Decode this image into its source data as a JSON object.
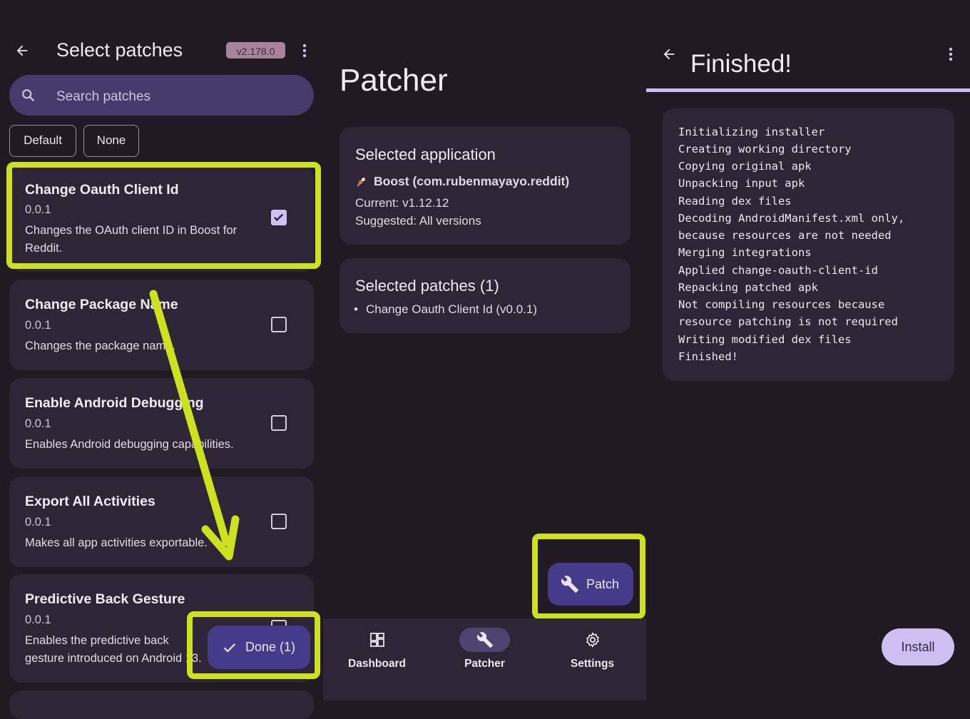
{
  "select_patches": {
    "title": "Select patches",
    "version_badge": "v2.178.0",
    "search_placeholder": "Search patches",
    "chips": [
      "Default",
      "None"
    ],
    "patches": [
      {
        "name": "Change Oauth Client Id",
        "version": "0.0.1",
        "desc": "Changes the OAuth client ID in Boost for Reddit.",
        "checked": true
      },
      {
        "name": "Change Package Name",
        "version": "0.0.1",
        "desc": "Changes the package name.",
        "checked": false
      },
      {
        "name": "Enable Android Debugging",
        "version": "0.0.1",
        "desc": "Enables Android debugging capabilities.",
        "checked": false
      },
      {
        "name": "Export All Activities",
        "version": "0.0.1",
        "desc": "Makes all app activities exportable.",
        "checked": false
      },
      {
        "name": "Predictive Back Gesture",
        "version": "0.0.1",
        "desc": "Enables the predictive back gesture introduced on Android 13.",
        "checked": false
      }
    ],
    "done_label": "Done (1)"
  },
  "patcher": {
    "title": "Patcher",
    "selected_application": {
      "heading": "Selected application",
      "app_name": "Boost (com.rubenmayayo.reddit)",
      "current": "Current: v1.12.12",
      "suggested": "Suggested: All versions"
    },
    "selected_patches": {
      "heading": "Selected patches (1)",
      "items": [
        "Change Oauth Client Id (v0.0.1)"
      ]
    },
    "patch_button": "Patch",
    "nav": [
      {
        "label": "Dashboard",
        "active": false
      },
      {
        "label": "Patcher",
        "active": true
      },
      {
        "label": "Settings",
        "active": false
      }
    ]
  },
  "finished": {
    "title": "Finished!",
    "log": [
      "Initializing installer",
      "Creating working directory",
      "Copying original apk",
      "Unpacking input apk",
      "Reading dex files",
      "Decoding AndroidManifest.xml only,",
      "because resources are not needed",
      "Merging integrations",
      "Applied change-oauth-client-id",
      "Repacking patched apk",
      "Not compiling resources because",
      "resource patching is not required",
      "Writing modified dex files",
      "Finished!"
    ],
    "install_button": "Install"
  },
  "colors": {
    "background": "#211a22",
    "card": "#2e2637",
    "accent": "#cfbff0",
    "highlight": "#cde11d",
    "button": "#463b8a"
  }
}
